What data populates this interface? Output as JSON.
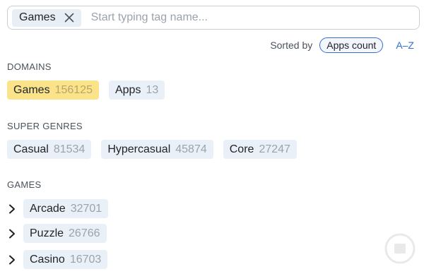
{
  "search": {
    "selected_tag": "Games",
    "placeholder": "Start typing tag name..."
  },
  "sort": {
    "label": "Sorted by",
    "active_option": "Apps count",
    "alt_option": "A–Z"
  },
  "domains": {
    "title": "DOMAINS",
    "items": [
      {
        "label": "Games",
        "count": "156125",
        "active": true
      },
      {
        "label": "Apps",
        "count": "13",
        "active": false
      }
    ]
  },
  "super_genres": {
    "title": "SUPER GENRES",
    "items": [
      {
        "label": "Casual",
        "count": "81534"
      },
      {
        "label": "Hypercasual",
        "count": "45874"
      },
      {
        "label": "Core",
        "count": "27247"
      }
    ]
  },
  "games": {
    "title": "GAMES",
    "items": [
      {
        "label": "Arcade",
        "count": "32701",
        "icon": "chevron-right-icon"
      },
      {
        "label": "Puzzle",
        "count": "26766",
        "icon": "chevron-right-icon"
      },
      {
        "label": "Casino",
        "count": "16703",
        "icon": "chevron-right-icon"
      }
    ]
  },
  "colors": {
    "accent": "#2f6fd6",
    "active_chip": "#fbe38a",
    "chip": "#eaf0f7"
  }
}
